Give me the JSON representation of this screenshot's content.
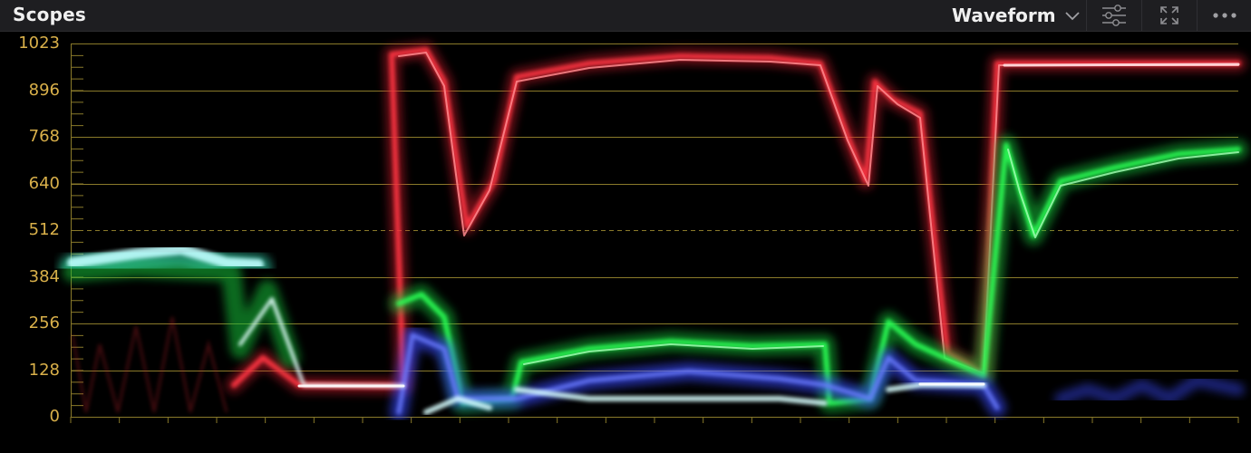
{
  "panel": {
    "title": "Scopes",
    "mode": "Waveform",
    "mode_icon": "chevron-down-icon",
    "toolbar_icons": [
      "sliders-icon",
      "expand-icon",
      "more-icon"
    ]
  },
  "scope": {
    "y_ticks": [
      "1023",
      "896",
      "768",
      "640",
      "512",
      "384",
      "256",
      "128",
      "0"
    ],
    "reference_line": "512",
    "colors": {
      "graticule": "#8a7a2a",
      "label": "#d9b04a",
      "red": "#ff3c46",
      "green": "#2cff55",
      "blue": "#5a6cff",
      "cyan": "#9effff"
    }
  }
}
